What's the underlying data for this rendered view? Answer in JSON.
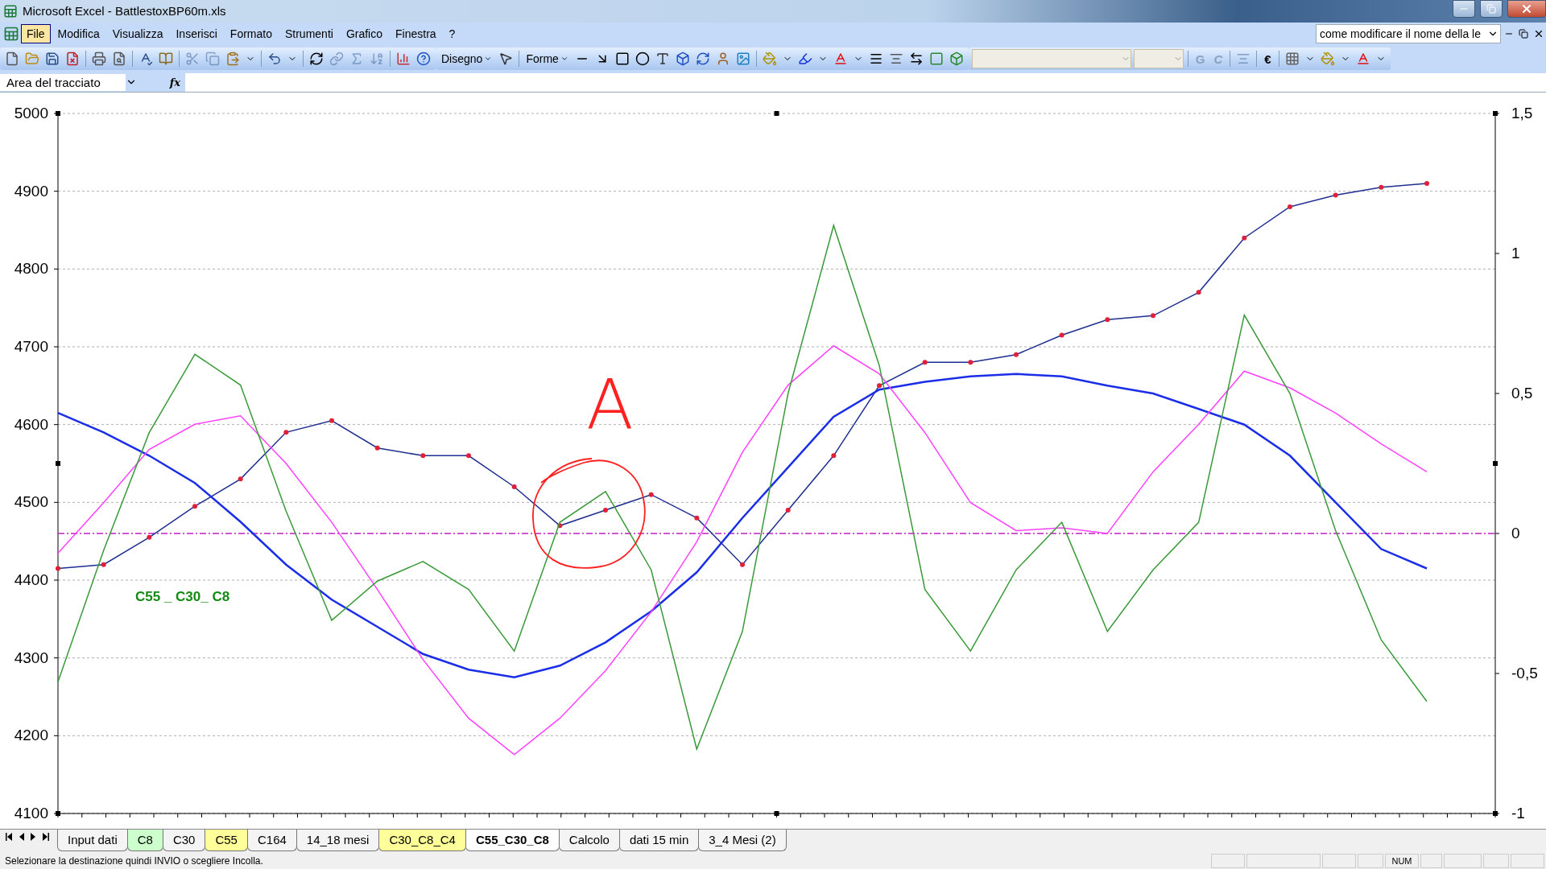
{
  "window": {
    "title": "Microsoft Excel - BattlestoxBP60m.xls"
  },
  "menu": [
    {
      "label": "File",
      "selected": true
    },
    {
      "label": "Modifica",
      "selected": false
    },
    {
      "label": "Visualizza",
      "selected": false
    },
    {
      "label": "Inserisci",
      "selected": false
    },
    {
      "label": "Formato",
      "selected": false
    },
    {
      "label": "Strumenti",
      "selected": false
    },
    {
      "label": "Grafico",
      "selected": false
    },
    {
      "label": "Finestra",
      "selected": false
    },
    {
      "label": "?",
      "selected": false
    }
  ],
  "ask_box": {
    "value": "come modificare il nome della le"
  },
  "drawing_toolbar": {
    "draw_menu": "Disegno",
    "shapes_menu": "Forme"
  },
  "format_toolbar": {
    "bold": "G",
    "italic": "C",
    "currency": "€"
  },
  "name_box": {
    "value": "Area del tracciato"
  },
  "formula_bar": {
    "fx": "fx"
  },
  "chart": {
    "series_label": "C55 _ C30_ C8",
    "hand_annotation": "A",
    "chart_data": {
      "type": "line",
      "ylim": [
        4100,
        5000
      ],
      "y2lim": [
        -1,
        1.5
      ],
      "yticks": [
        4100,
        4200,
        4300,
        4400,
        4500,
        4600,
        4700,
        4800,
        4900,
        5000
      ],
      "y2ticks": [
        {
          "value": -1,
          "label": "-1"
        },
        {
          "value": -0.5,
          "label": "-0,5"
        },
        {
          "value": 0,
          "label": "0"
        },
        {
          "value": 0.5,
          "label": "0,5"
        },
        {
          "value": 1,
          "label": "1"
        },
        {
          "value": 1.5,
          "label": "1,5"
        }
      ],
      "series": [
        {
          "color": "#1f2f8f",
          "marker": "circle",
          "values": [
            4415,
            4420,
            4455,
            4495,
            4530,
            4590,
            4605,
            4570,
            4560,
            4560,
            4520,
            4470,
            4490,
            4510,
            4480,
            4420,
            4490,
            4560,
            4650,
            4680,
            4680,
            4690,
            4715,
            4735,
            4740,
            4770,
            4840,
            4880,
            4895,
            4905,
            4910
          ]
        },
        {
          "color": "#1a2ee8",
          "values": [
            4615,
            4590,
            4560,
            4525,
            4475,
            4420,
            4375,
            4340,
            4305,
            4285,
            4275,
            4290,
            4320,
            4360,
            4410,
            4480,
            4545,
            4610,
            4645,
            4655,
            4662,
            4665,
            4662,
            4650,
            4640,
            4620,
            4600,
            4560,
            4500,
            4440,
            4415
          ]
        },
        {
          "color": "#ff40ff",
          "axis": "y2",
          "values": [
            -0.07,
            0.11,
            0.3,
            0.39,
            0.42,
            0.25,
            0.04,
            -0.2,
            -0.45,
            -0.66,
            -0.79,
            -0.66,
            -0.49,
            -0.28,
            -0.03,
            0.29,
            0.53,
            0.67,
            0.57,
            0.36,
            0.11,
            0.01,
            0.02,
            0,
            0.22,
            0.39,
            0.58,
            0.52,
            0.43,
            0.32,
            0.22
          ]
        },
        {
          "color": "#3a9a3a",
          "axis": "y2",
          "values": [
            -0.53,
            -0.06,
            0.36,
            0.64,
            0.53,
            0.08,
            -0.31,
            -0.17,
            -0.1,
            -0.2,
            -0.42,
            0.04,
            0.15,
            -0.13,
            -0.77,
            -0.35,
            0.5,
            1.1,
            0.6,
            -0.2,
            -0.42,
            -0.13,
            0.04,
            -0.35,
            -0.13,
            0.04,
            0.78,
            0.5,
            0.01,
            -0.38,
            -0.6
          ]
        }
      ],
      "grid": true,
      "ref_lines": [
        {
          "value": 0,
          "axis": "y2"
        }
      ]
    }
  },
  "sheet_tabs": [
    {
      "label": "Input dati",
      "selected": false
    },
    {
      "label": "C8",
      "selected": false,
      "color": "#ccffcc"
    },
    {
      "label": "C30",
      "selected": false
    },
    {
      "label": "C55",
      "selected": false,
      "color": "#ffff99"
    },
    {
      "label": "C164",
      "selected": false
    },
    {
      "label": "14_18 mesi",
      "selected": false
    },
    {
      "label": "C30_C8_C4",
      "selected": false,
      "color": "#ffff99"
    },
    {
      "label": "C55_C30_C8",
      "selected": true
    },
    {
      "label": "Calcolo",
      "selected": false
    },
    {
      "label": "dati 15 min",
      "selected": false
    },
    {
      "label": "3_4 Mesi (2)",
      "selected": false
    }
  ],
  "status_bar": {
    "message": "Selezionare la destinazione quindi INVIO o scegliere Incolla.",
    "indicators": [
      "NUM"
    ]
  }
}
